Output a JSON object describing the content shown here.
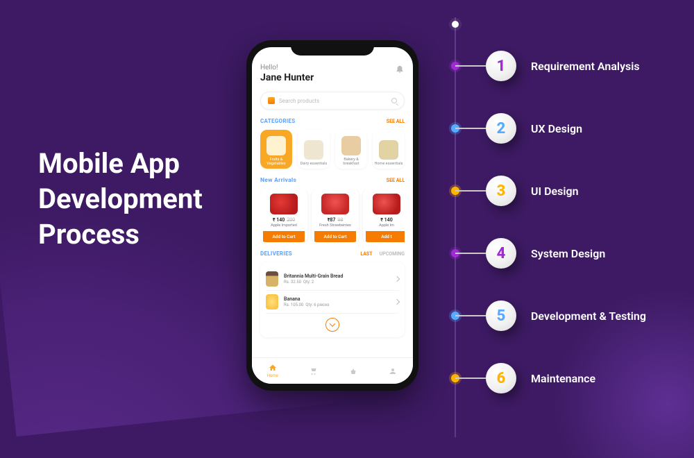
{
  "headline": {
    "line1": "Mobile App",
    "line2": "Development",
    "line3": "Process"
  },
  "phone": {
    "greeting": "Hello!",
    "user_name": "Jane Hunter",
    "search_placeholder": "Search products",
    "see_all": "SEE ALL",
    "sections": {
      "categories": "CATEGORIES",
      "new_arrivals": "New Arrivals",
      "deliveries": "DELIVERIES"
    },
    "categories": [
      {
        "label": "Fruits & Vegetables"
      },
      {
        "label": "Dairy essentials"
      },
      {
        "label": "Bakery & breakfast"
      },
      {
        "label": "Home essentials"
      }
    ],
    "products": [
      {
        "price": "₹ 140",
        "old": "200",
        "name": "Apple Imported",
        "btn": "Add to Cart"
      },
      {
        "price": "₹87",
        "old": "98",
        "name": "Fresh Strawberries",
        "btn": "Add to Cart"
      },
      {
        "price": "₹ 140",
        "old": "",
        "name": "Apple Im",
        "btn": "Add t"
      }
    ],
    "tabs": {
      "last": "LAST",
      "upcoming": "UPCOMING"
    },
    "deliveries": [
      {
        "name": "Britannia Multi-Grain Bread",
        "price": "Rs. 32.50",
        "qty": "Qty: 2"
      },
      {
        "name": "Banana",
        "price": "Rs. 105.00",
        "qty": "Qty: 6 pieces"
      }
    ],
    "navbar": {
      "home": "Home"
    }
  },
  "steps": [
    {
      "num": "1",
      "label": "Requirement Analysis",
      "color": "p"
    },
    {
      "num": "2",
      "label": "UX Design",
      "color": "b"
    },
    {
      "num": "3",
      "label": "UI Design",
      "color": "o"
    },
    {
      "num": "4",
      "label": "System Design",
      "color": "p"
    },
    {
      "num": "5",
      "label": "Development & Testing",
      "color": "b"
    },
    {
      "num": "6",
      "label": "Maintenance",
      "color": "o"
    }
  ]
}
